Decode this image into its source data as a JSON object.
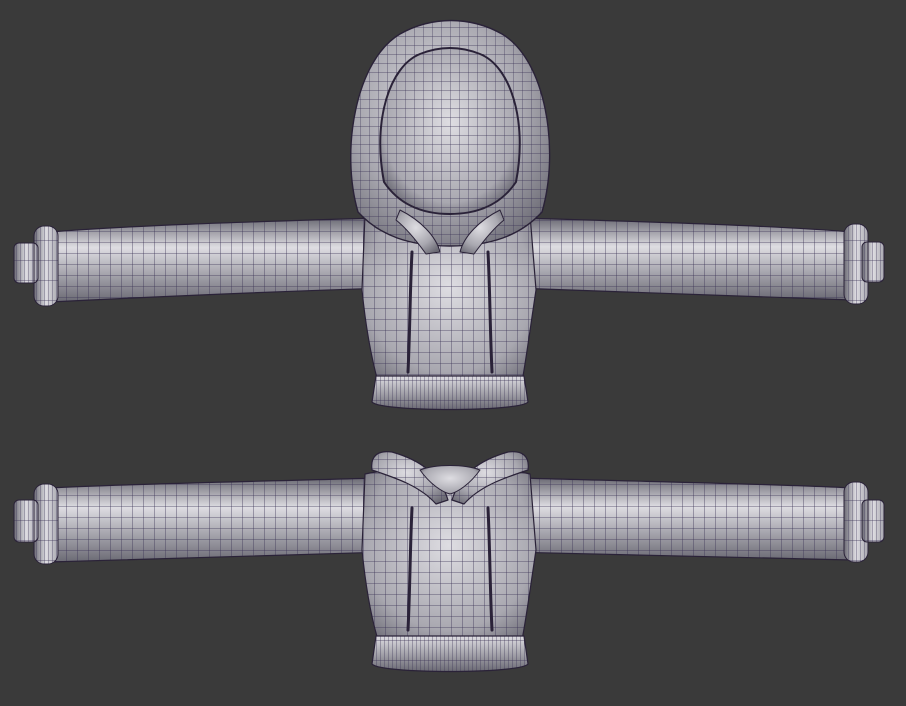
{
  "viewport": {
    "background_color": "#3a3a3a",
    "shading_light": "#dedde2",
    "shading_mid": "#a9a8b0",
    "shading_dark": "#6b6a74",
    "wire_color": "#3c3456",
    "seam_color": "#2a2238"
  },
  "models": [
    {
      "name": "hoodie-with-hood-up",
      "hood": true
    },
    {
      "name": "hoodie-hood-down",
      "hood": false
    }
  ]
}
